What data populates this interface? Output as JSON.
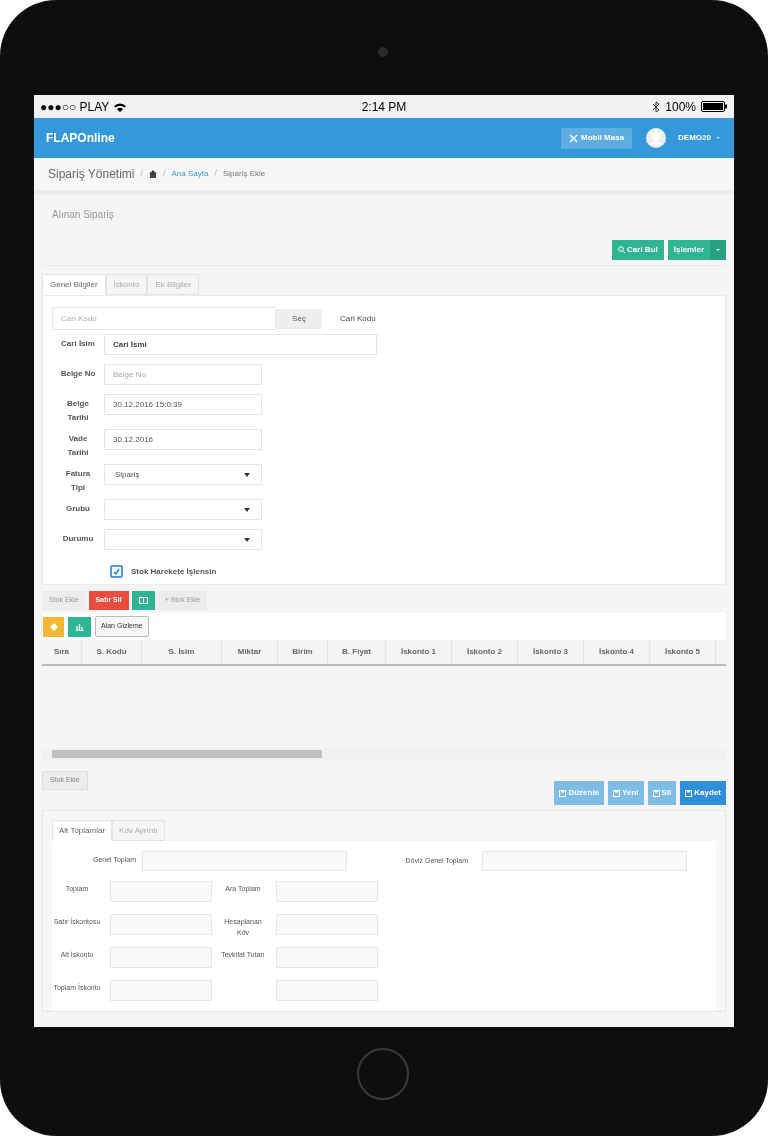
{
  "status_bar": {
    "carrier": "●●●○○ PLAY",
    "time": "2:14 PM",
    "battery": "100%"
  },
  "navbar": {
    "brand": "FLAPOnline",
    "mobile_button": "Mobil Masa",
    "user": "DEMO20"
  },
  "breadcrumb": {
    "title": "Sipariş Yönetimi",
    "separator": "/",
    "items": [
      {
        "label": "Ana Sayfa",
        "kind": "link"
      },
      {
        "label": "Sipariş Ekle",
        "kind": "current"
      }
    ]
  },
  "panel_title": "Alınan Sipariş",
  "actions": [
    {
      "label": "Cari Bul",
      "kind": "button"
    },
    {
      "label": "İşlemler",
      "kind": "dropdown"
    }
  ],
  "tabs": [
    {
      "label": "Genel Bilgiler",
      "selected": true
    },
    {
      "label": "İskonto",
      "selected": false
    },
    {
      "label": "Ek Bilgiler",
      "selected": false
    }
  ],
  "cari_kodu": {
    "placeholder": "Cari Kodu",
    "button": "Seç",
    "label": "Cari Kodu"
  },
  "form": [
    {
      "label": "Cari İsim",
      "kind": "wide",
      "value": "Cari İsmi"
    },
    {
      "label": "Belge No",
      "kind": "text",
      "placeholder": "Belge No"
    },
    {
      "label": "Belge Tarihi",
      "kind": "text",
      "value": "30.12.2016 15:0:39"
    },
    {
      "label": "Vade Tarihi",
      "kind": "text",
      "value": "30.12.2016"
    },
    {
      "label": "Fatura Tipi",
      "kind": "select",
      "value": "Sipariş"
    },
    {
      "label": "Grubu",
      "kind": "select"
    },
    {
      "label": "Durumu",
      "kind": "select"
    }
  ],
  "stock_checkbox": {
    "label": "Stok Harekete İşlensin",
    "checked": true
  },
  "row_toolbar": [
    {
      "label": "Stok Ekle",
      "kind": "default"
    },
    {
      "label": "Satır Sil",
      "kind": "danger"
    },
    {
      "kind": "excel"
    },
    {
      "label": "+ Stok Ekle",
      "kind": "default"
    }
  ],
  "grid_toolbar": {
    "hide_button": "Alan Gizleme"
  },
  "table": {
    "columns": [
      "Sıra",
      "S. Kodu",
      "S. İsim",
      "Miktar",
      "Birim",
      "B. Fiyat",
      "İskonto 1",
      "İskonto 2",
      "İskonto 3",
      "İskonto 4",
      "İskonto 5"
    ]
  },
  "bottom_button": "Stok Ekle",
  "form_actions": [
    {
      "label": "Düzenle",
      "disabled": true
    },
    {
      "label": "Yeni",
      "disabled": true
    },
    {
      "label": "Sil",
      "disabled": true
    },
    {
      "label": "Kaydet",
      "disabled": false
    }
  ],
  "totals_tabs": [
    {
      "label": "Alt Toplamlar",
      "selected": true
    },
    {
      "label": "Kdv Ayrıntı",
      "selected": false
    }
  ],
  "totals": {
    "genel_toplam": "Genel Toplam",
    "doviz_genel_toplam": "Döviz Genel Toplam",
    "left": [
      {
        "label": "Toplam"
      },
      {
        "label": "Satır İskontosu"
      },
      {
        "label": "Alt İskonto"
      },
      {
        "label": "Toplam İskonto"
      }
    ],
    "right": [
      {
        "label": "Ara Toplam"
      },
      {
        "label": "Hesaplanan Kdv"
      },
      {
        "label": "Tevkifat Tutarı"
      }
    ]
  }
}
